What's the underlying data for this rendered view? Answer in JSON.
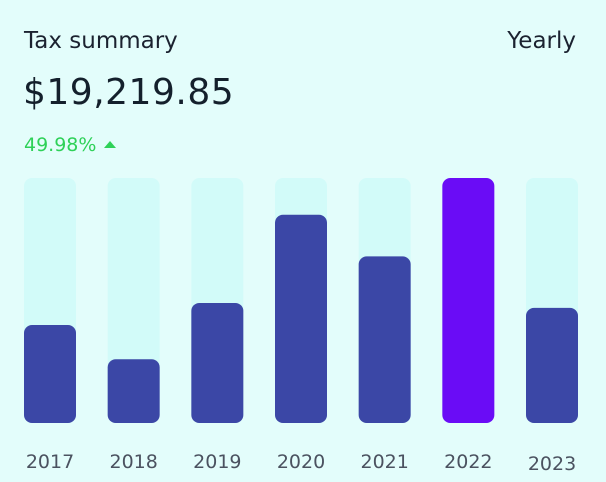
{
  "header": {
    "title": "Tax summary",
    "period": "Yearly"
  },
  "summary": {
    "total": "$19,219.85",
    "change": "49.98%",
    "change_icon": "triangle-up-icon",
    "change_color": "#2ed158"
  },
  "colors": {
    "bar": "#3b47a6",
    "bar_highlight": "#6a0cf6",
    "track": "#d2fbf9",
    "tick_text": "#4b5260"
  },
  "chart_data": {
    "type": "bar",
    "categories": [
      "2017",
      "2018",
      "2019",
      "2020",
      "2021",
      "2022",
      "2023"
    ],
    "values": [
      40,
      26,
      49,
      85,
      68,
      100,
      47
    ],
    "highlight_index": 5,
    "ylim": [
      0,
      100
    ],
    "title": "",
    "xlabel": "",
    "ylabel": "",
    "grid": false,
    "legend": "none"
  }
}
